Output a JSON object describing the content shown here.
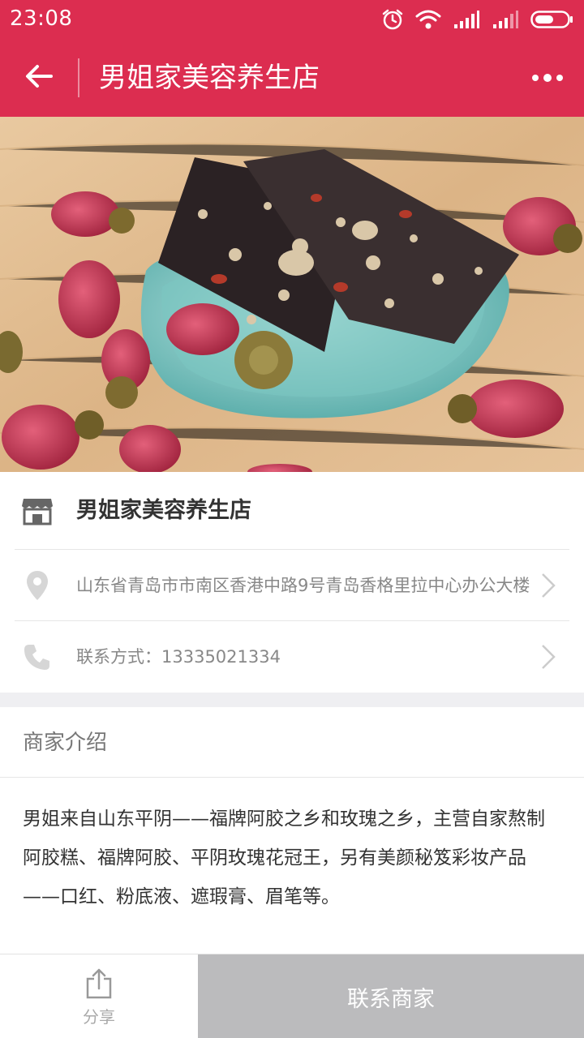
{
  "status_bar": {
    "time": "23:08",
    "icons": [
      "alarm-icon",
      "wifi-icon",
      "signal-icon",
      "signal-icon",
      "battery-icon"
    ]
  },
  "header": {
    "title": "男姐家美容养生店",
    "back_icon": "back-arrow-icon",
    "more_icon": "more-dots-icon"
  },
  "colors": {
    "brand": "#dc2d50",
    "button_disabled": "#bbbbbd"
  },
  "hero": {
    "image_subject": "black sesame walnut donkey-hide gelatin cake on a teal dish with dried rose buds"
  },
  "shop": {
    "name": "男姐家美容养生店",
    "name_icon": "store-icon",
    "address": "山东省青岛市市南区香港中路9号青岛香格里拉中心办公大楼",
    "address_icon": "location-pin-icon",
    "contact_label": "联系方式：",
    "contact_value": "13335021334",
    "contact_icon": "phone-icon"
  },
  "intro": {
    "title": "商家介绍",
    "body": "男姐来自山东平阴——福牌阿胶之乡和玫瑰之乡，主营自家熬制阿胶糕、福牌阿胶、平阴玫瑰花冠王，另有美颜秘笈彩妆产品——口红、粉底液、遮瑕膏、眉笔等。"
  },
  "bottom_bar": {
    "share_label": "分享",
    "contact_button": "联系商家"
  }
}
